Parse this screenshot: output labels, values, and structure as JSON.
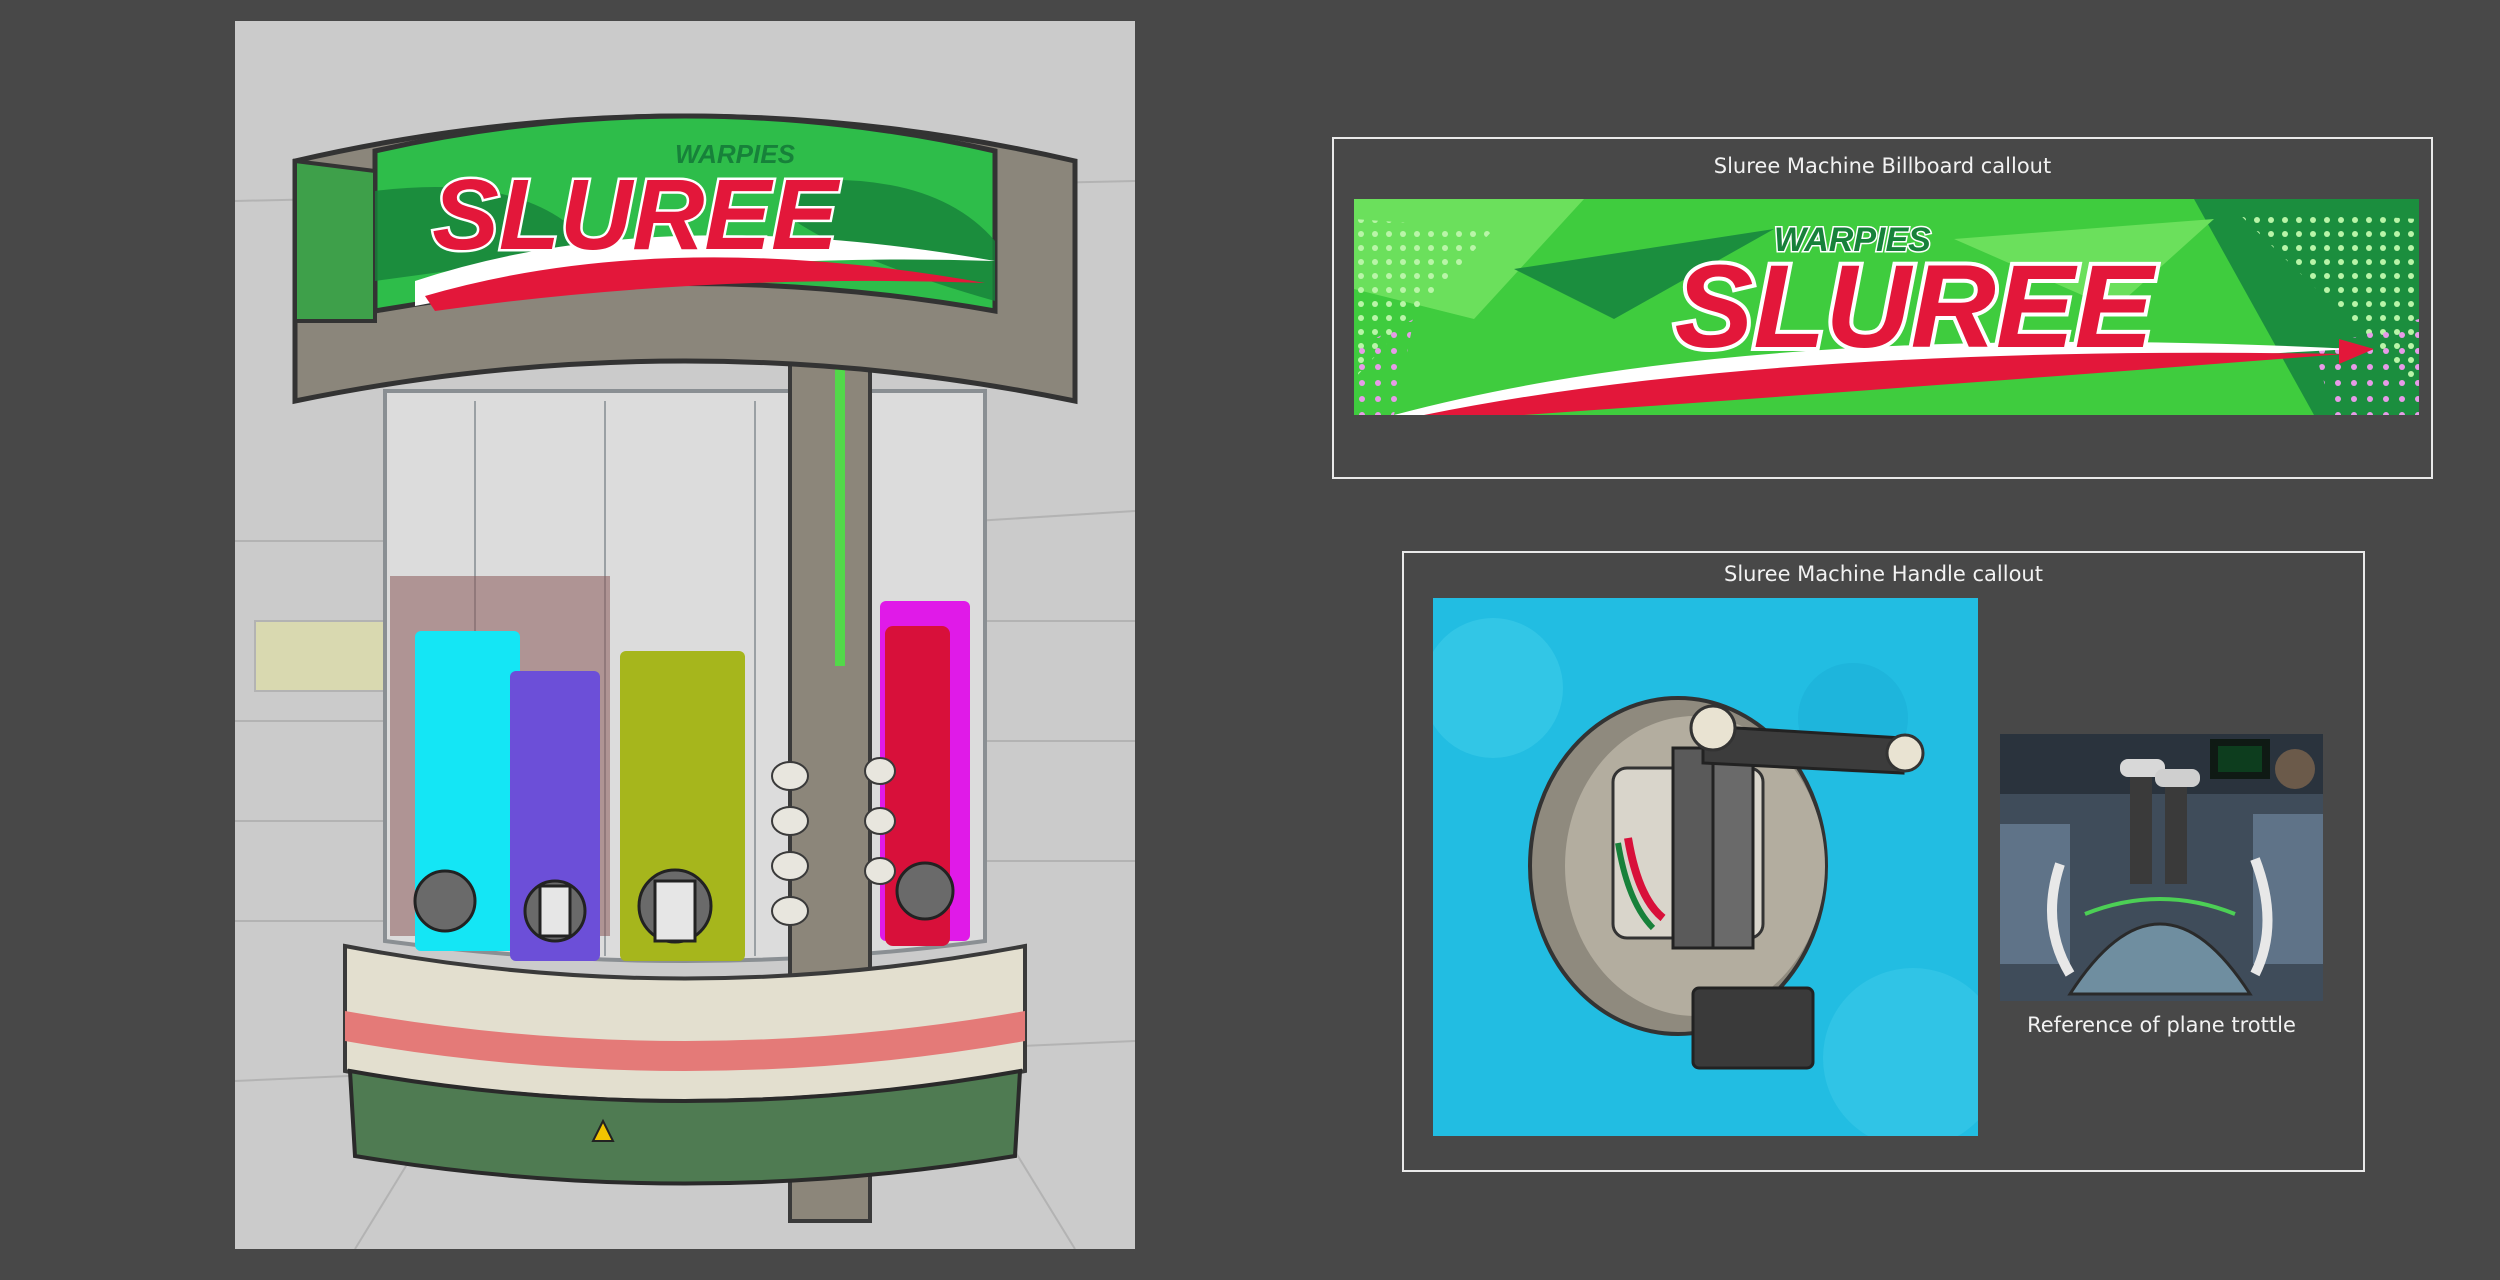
{
  "concept_sheet": {
    "brand": {
      "sub_name": "WARPIES",
      "main_name": "SLUREE",
      "colors": {
        "red": "#e3173a",
        "green_light": "#4fd14a",
        "green_dark": "#17813a",
        "white": "#ffffff"
      }
    },
    "machine_illustration": {
      "syrup_colors": [
        "#14e6f5",
        "#6c4fd8",
        "#a6b61c",
        "#d8103a",
        "#e01ae8"
      ],
      "base_stripe_color": "#e47a78",
      "base_green": "#4f7b52"
    },
    "billboard_callout": {
      "title": "Sluree Machine Billboard callout"
    },
    "handle_callout": {
      "title": "Sluree Machine Handle callout",
      "reference_caption": "Reference of plane trottle",
      "panel_color": "#22bde2"
    }
  }
}
